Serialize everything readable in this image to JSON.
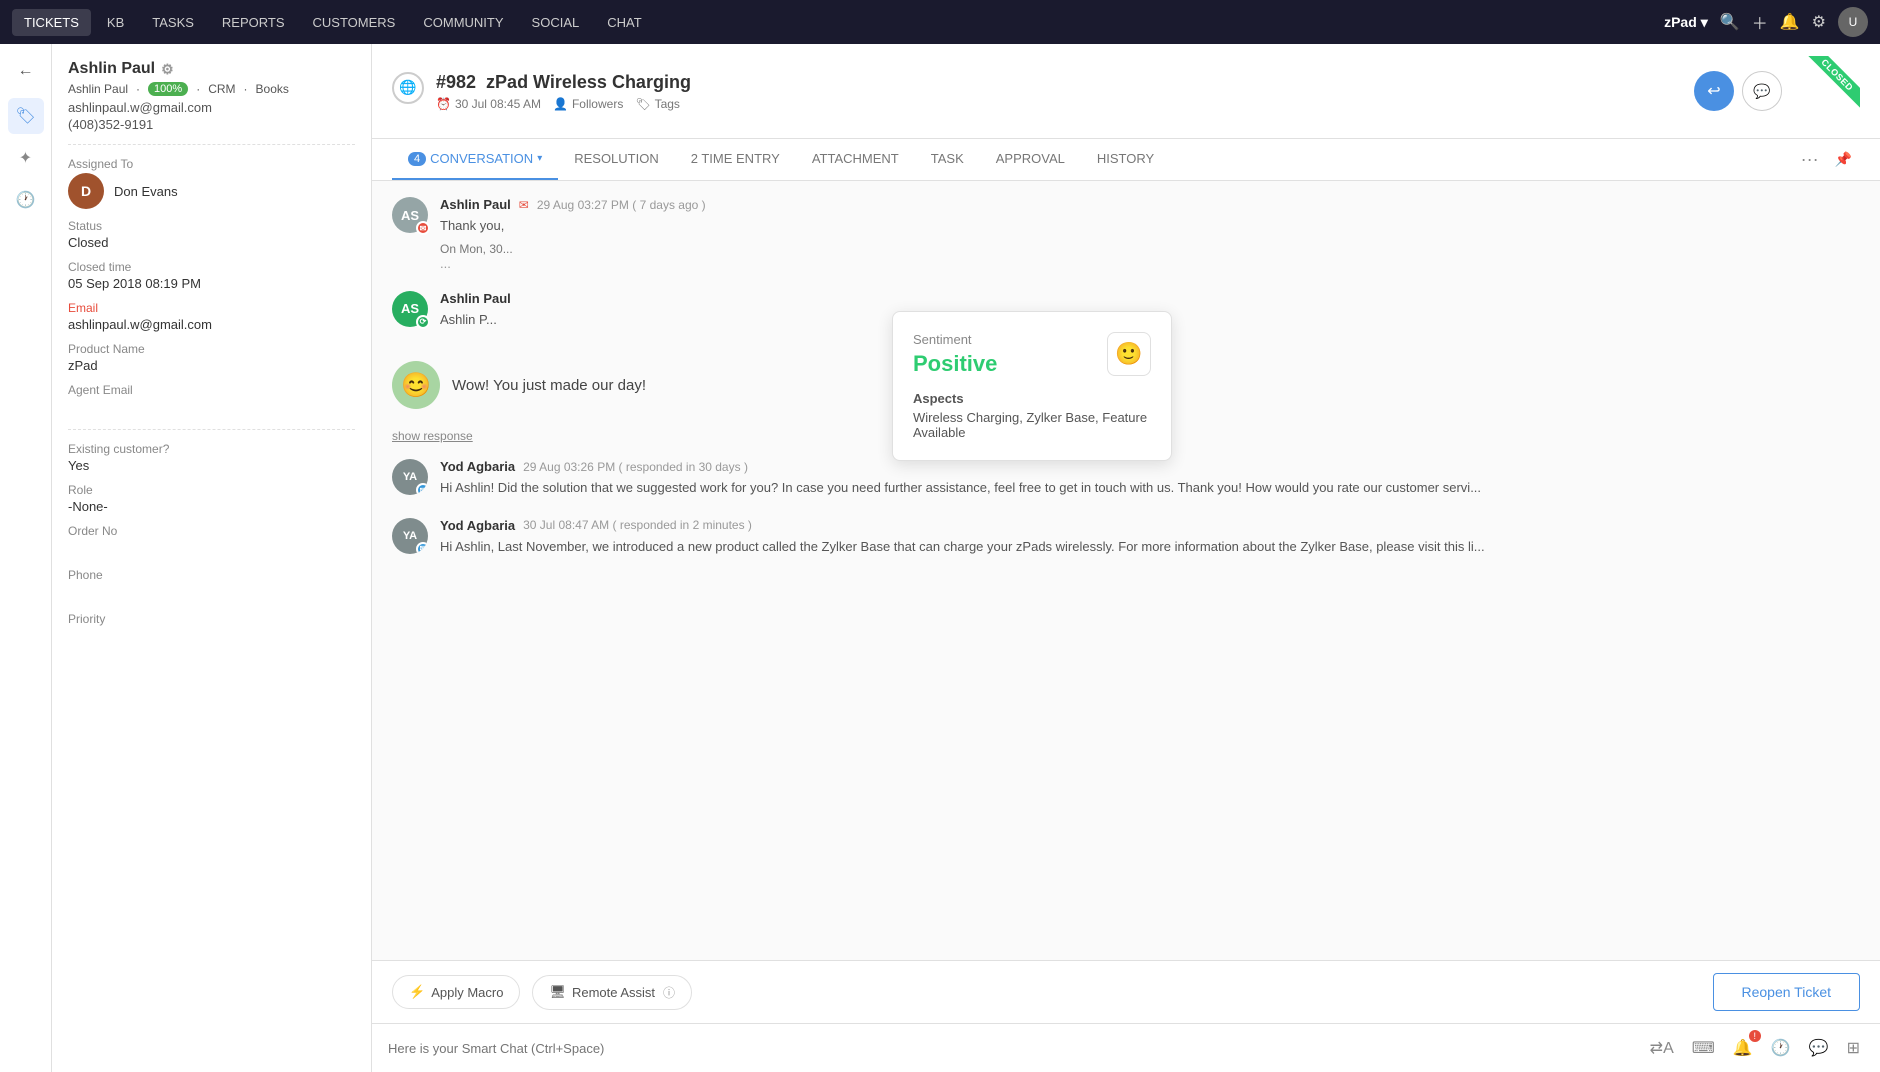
{
  "topNav": {
    "items": [
      {
        "label": "TICKETS",
        "active": true
      },
      {
        "label": "KB",
        "active": false
      },
      {
        "label": "TASKS",
        "active": false
      },
      {
        "label": "REPORTS",
        "active": false
      },
      {
        "label": "CUSTOMERS",
        "active": false
      },
      {
        "label": "COMMUNITY",
        "active": false
      },
      {
        "label": "SOCIAL",
        "active": false
      },
      {
        "label": "CHAT",
        "active": false
      }
    ],
    "brand": "zPad",
    "user_avatar": "U"
  },
  "customer": {
    "name": "Ashlin Paul",
    "sub_label1": "100%",
    "sub_label2": "CRM",
    "sub_label3": "Books",
    "email": "ashlinpaul.w@gmail.com",
    "phone": "(408)352-9191",
    "assigned_to_label": "Assigned To",
    "assigned_agent": "Don Evans",
    "status_label": "Status",
    "status_value": "Closed",
    "closed_time_label": "Closed time",
    "closed_time_value": "05 Sep 2018 08:19 PM",
    "email_label": "Email",
    "email_value": "ashlinpaul.w@gmail.com",
    "product_label": "Product Name",
    "product_value": "zPad",
    "agent_email_label": "Agent Email",
    "agent_email_value": "",
    "existing_customer_label": "Existing customer?",
    "existing_customer_value": "Yes",
    "role_label": "Role",
    "role_value": "-None-",
    "order_label": "Order No",
    "order_value": "",
    "phone_label": "Phone",
    "phone_value": "",
    "priority_label": "Priority",
    "priority_value": ""
  },
  "ticket": {
    "id": "#982",
    "title": "zPad Wireless Charging",
    "date": "30 Jul 08:45 AM",
    "followers": "Followers",
    "tags": "Tags"
  },
  "tabs": [
    {
      "label": "CONVERSATION",
      "badge": "4",
      "active": true
    },
    {
      "label": "RESOLUTION",
      "badge": "",
      "active": false
    },
    {
      "label": "2 TIME ENTRY",
      "badge": "",
      "active": false
    },
    {
      "label": "ATTACHMENT",
      "badge": "",
      "active": false
    },
    {
      "label": "TASK",
      "badge": "",
      "active": false
    },
    {
      "label": "APPROVAL",
      "badge": "",
      "active": false
    },
    {
      "label": "HISTORY",
      "badge": "",
      "active": false
    }
  ],
  "messages": [
    {
      "sender": "Ashlin Paul",
      "avatar_initials": "AS",
      "time": "29 Aug 03:27 PM ( 7 days ago )",
      "body": "Thank you,",
      "quoted": "On Mon, 30...",
      "show_dots": true
    },
    {
      "sender": "Ashlin Paul",
      "avatar_initials": "AS",
      "time": "",
      "body": "Ashlin P...",
      "quoted": ""
    }
  ],
  "smiley_message": "Wow! You just made our day!",
  "show_response_label": "show response",
  "messages2": [
    {
      "sender": "Yod Agbaria",
      "avatar_initials": "YA",
      "time": "29 Aug 03:26 PM ( responded in 30 days )",
      "body": "Hi Ashlin! Did the solution that we suggested work for you? In case you need further assistance, feel free to get in touch with us. Thank you! How would you rate our customer servi..."
    },
    {
      "sender": "Yod Agbaria",
      "avatar_initials": "YA",
      "time": "30 Jul 08:47 AM ( responded in 2 minutes )",
      "body": "Hi Ashlin, Last November, we introduced a new product called the Zylker Base that can charge your zPads wirelessly. For more information about the Zylker Base, please visit this li..."
    }
  ],
  "sentiment": {
    "title": "Sentiment",
    "value": "Positive",
    "aspects_title": "Aspects",
    "aspects": "Wireless Charging, Zylker Base, Feature Available"
  },
  "bottomBar": {
    "apply_macro_label": "Apply Macro",
    "remote_assist_label": "Remote Assist",
    "reopen_label": "Reopen Ticket"
  },
  "smartChat": {
    "placeholder": "Here is your Smart Chat (Ctrl+Space)"
  },
  "closedLabel": "CLOSED"
}
